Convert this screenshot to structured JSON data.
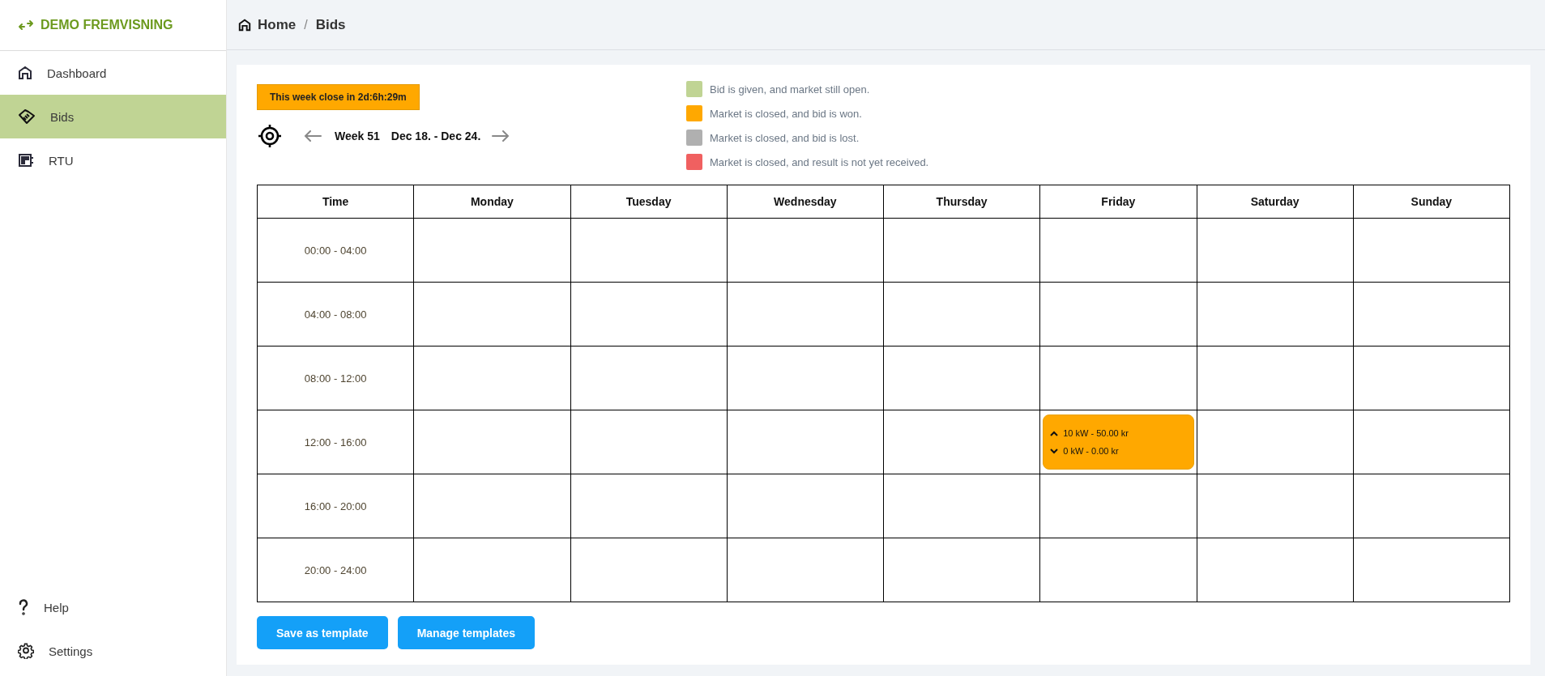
{
  "brand": {
    "title": "DEMO FREMVISNING"
  },
  "sidebar": {
    "items": [
      {
        "label": "Dashboard",
        "kind": "home",
        "selected": false
      },
      {
        "label": "Bids",
        "kind": "bids",
        "selected": true
      },
      {
        "label": "RTU",
        "kind": "rtu",
        "selected": false
      }
    ],
    "bottom_items": [
      {
        "label": "Help",
        "kind": "help"
      },
      {
        "label": "Settings",
        "kind": "settings"
      }
    ]
  },
  "breadcrumb": [
    "Home",
    "Bids"
  ],
  "breadcrumb_separator": "/",
  "countdown": "This week close in 2d:6h:29m",
  "week": {
    "label": "Week 51",
    "range": "Dec 18. - Dec 24."
  },
  "legend": [
    {
      "label": "Bid is given, and market still open.",
      "color": "#c0d494"
    },
    {
      "label": "Market is closed, and bid is won.",
      "color": "#ffa800"
    },
    {
      "label": "Market is closed, and bid is lost.",
      "color": "#b0b0b0"
    },
    {
      "label": "Market is closed, and result is not yet received.",
      "color": "#f06060"
    }
  ],
  "table": {
    "columns": [
      "Time",
      "Monday",
      "Tuesday",
      "Wednesday",
      "Thursday",
      "Friday",
      "Saturday",
      "Sunday"
    ],
    "rows": [
      {
        "cells": [
          "00:00 - 04:00",
          "",
          "",
          "",
          "",
          "",
          "",
          ""
        ]
      },
      {
        "cells": [
          "04:00 - 08:00",
          "",
          "",
          "",
          "",
          "",
          "",
          ""
        ]
      },
      {
        "cells": [
          "08:00 - 12:00",
          "",
          "",
          "",
          "",
          "",
          "",
          ""
        ]
      },
      {
        "cells": [
          "12:00 - 16:00",
          "",
          "",
          "",
          "",
          {
            "color": "#ffa800",
            "up": "10 kW - 50.00 kr",
            "down": "0 kW - 0.00 kr"
          },
          "",
          ""
        ]
      },
      {
        "cells": [
          "16:00 - 20:00",
          "",
          "",
          "",
          "",
          "",
          "",
          ""
        ]
      },
      {
        "cells": [
          "20:00 - 24:00",
          "",
          "",
          "",
          "",
          "",
          "",
          ""
        ]
      }
    ]
  },
  "buttons": [
    "Save as template",
    "Manage templates"
  ]
}
